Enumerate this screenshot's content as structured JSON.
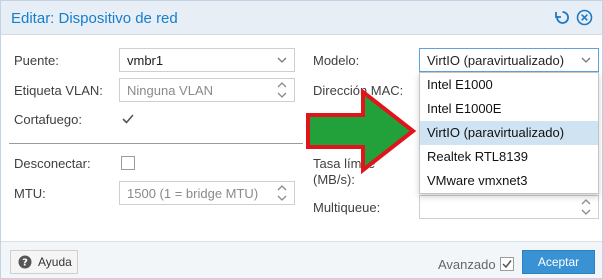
{
  "dialog": {
    "title": "Editar: Dispositivo de red"
  },
  "left": {
    "bridge_label": "Puente:",
    "bridge_value": "vmbr1",
    "vlan_label": "Etiqueta VLAN:",
    "vlan_value": "Ninguna VLAN",
    "firewall_label": "Cortafuego:",
    "firewall_checked": true,
    "disconnect_label": "Desconectar:",
    "disconnect_checked": false,
    "mtu_label": "MTU:",
    "mtu_value": "1500 (1 = bridge MTU)"
  },
  "right": {
    "model_label": "Modelo:",
    "model_value": "VirtIO (paravirtualizado)",
    "mac_label": "Dirección MAC:",
    "rate_label_1": "Tasa límite",
    "rate_label_2": "(MB/s):",
    "multiqueue_label": "Multiqueue:"
  },
  "dropdown": {
    "options": [
      "Intel E1000",
      "Intel E1000E",
      "VirtIO (paravirtualizado)",
      "Realtek RTL8139",
      "VMware vmxnet3"
    ],
    "selected_index": 2
  },
  "footer": {
    "help_label": "Ayuda",
    "advanced_label": "Avanzado",
    "advanced_checked": true,
    "ok_label": "Aceptar"
  },
  "colors": {
    "accent": "#157fcc",
    "primary_button": "#3892d4",
    "arrow_fill": "#22a03a",
    "arrow_stroke": "#e0151b",
    "selected_row": "#cfe3f3"
  }
}
